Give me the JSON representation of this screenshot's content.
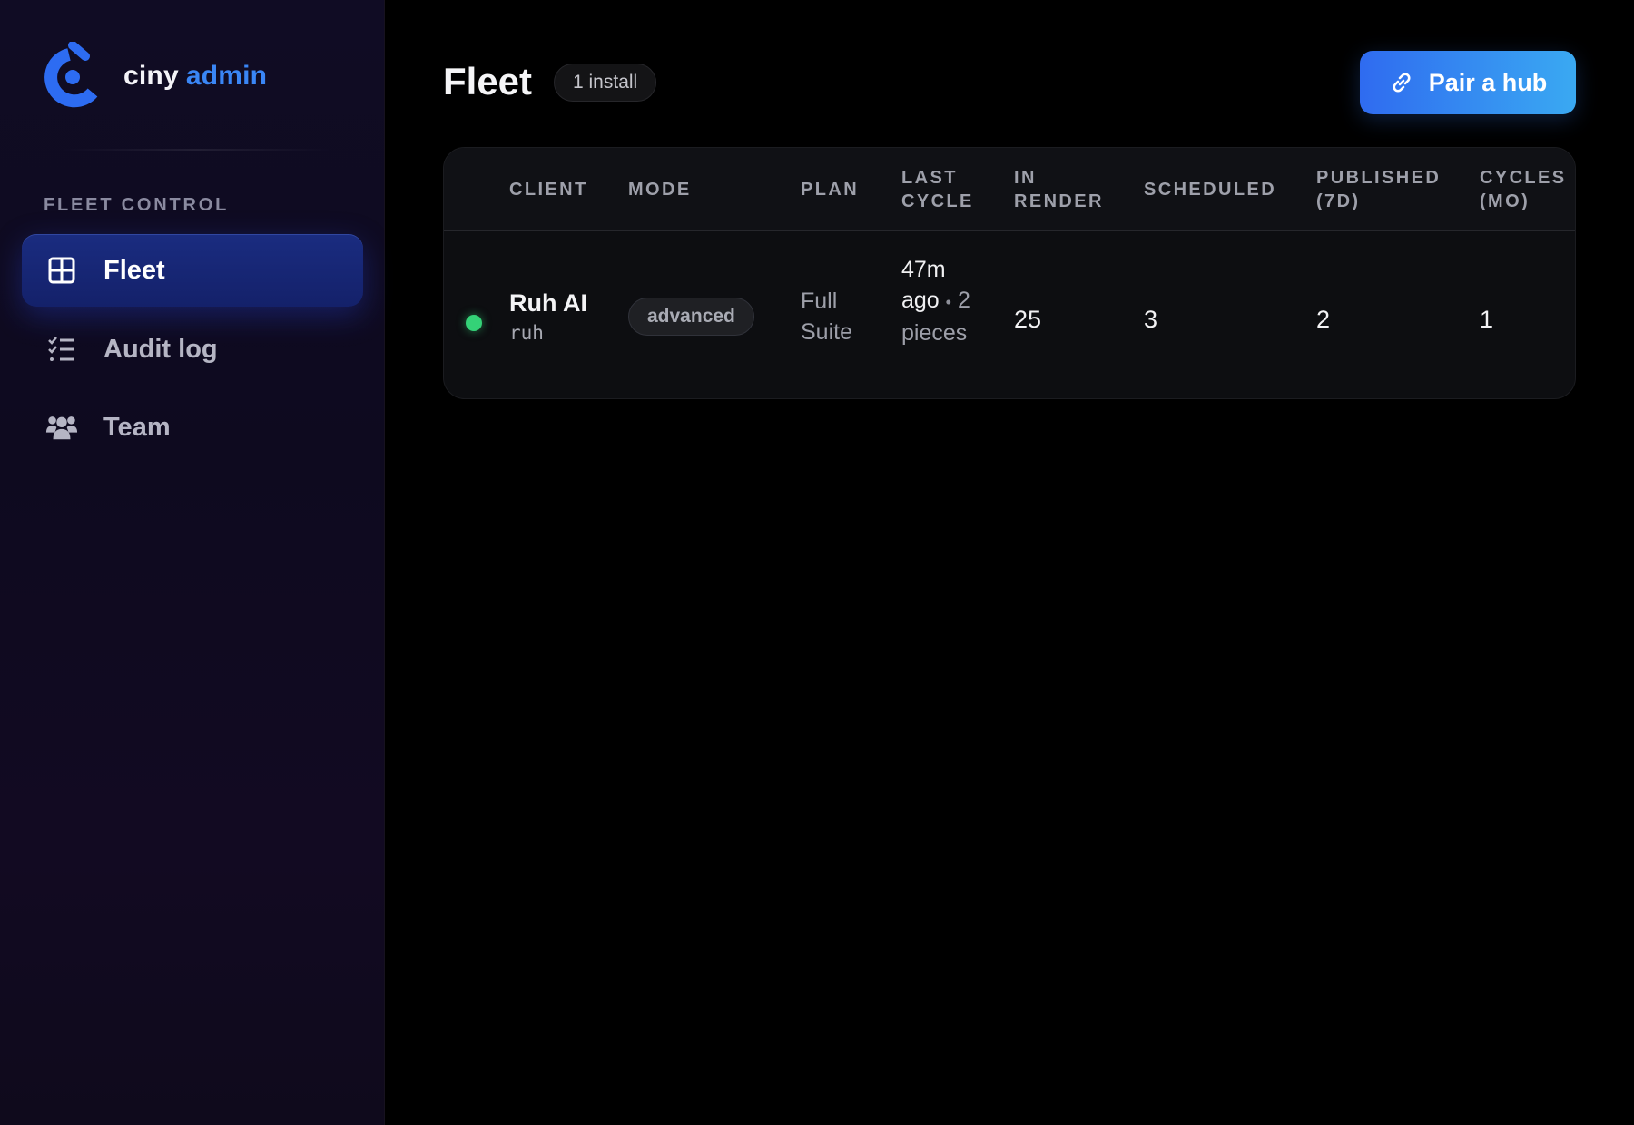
{
  "brand": {
    "name_part1": "ciny",
    "name_part2": "admin"
  },
  "sidebar": {
    "section_label": "FLEET CONTROL",
    "items": [
      {
        "label": "Fleet",
        "icon": "grid-icon",
        "active": true
      },
      {
        "label": "Audit log",
        "icon": "checklist-icon",
        "active": false
      },
      {
        "label": "Team",
        "icon": "users-icon",
        "active": false
      }
    ]
  },
  "header": {
    "title": "Fleet",
    "count_badge": "1 install",
    "pair_button": {
      "label": "Pair a hub",
      "icon": "link-icon"
    }
  },
  "table": {
    "columns": [
      "CLIENT",
      "MODE",
      "PLAN",
      "LAST CYCLE",
      "IN RENDER",
      "SCHEDULED",
      "PUBLISHED (7D)",
      "CYCLES (MO)"
    ],
    "rows": [
      {
        "status": "online",
        "client_name": "Ruh AI",
        "client_slug": "ruh",
        "mode": "advanced",
        "plan": "Full Suite",
        "last_cycle_time": "47m ago",
        "last_cycle_separator": "•",
        "last_cycle_pieces": "2 pieces",
        "in_render": "25",
        "scheduled": "3",
        "published_7d": "2",
        "cycles_mo": "1"
      }
    ]
  },
  "colors": {
    "accent": "#3a86f5",
    "status_online": "#34d277",
    "button_gradient_start": "#2f6bf0",
    "button_gradient_end": "#3aa9f2"
  }
}
